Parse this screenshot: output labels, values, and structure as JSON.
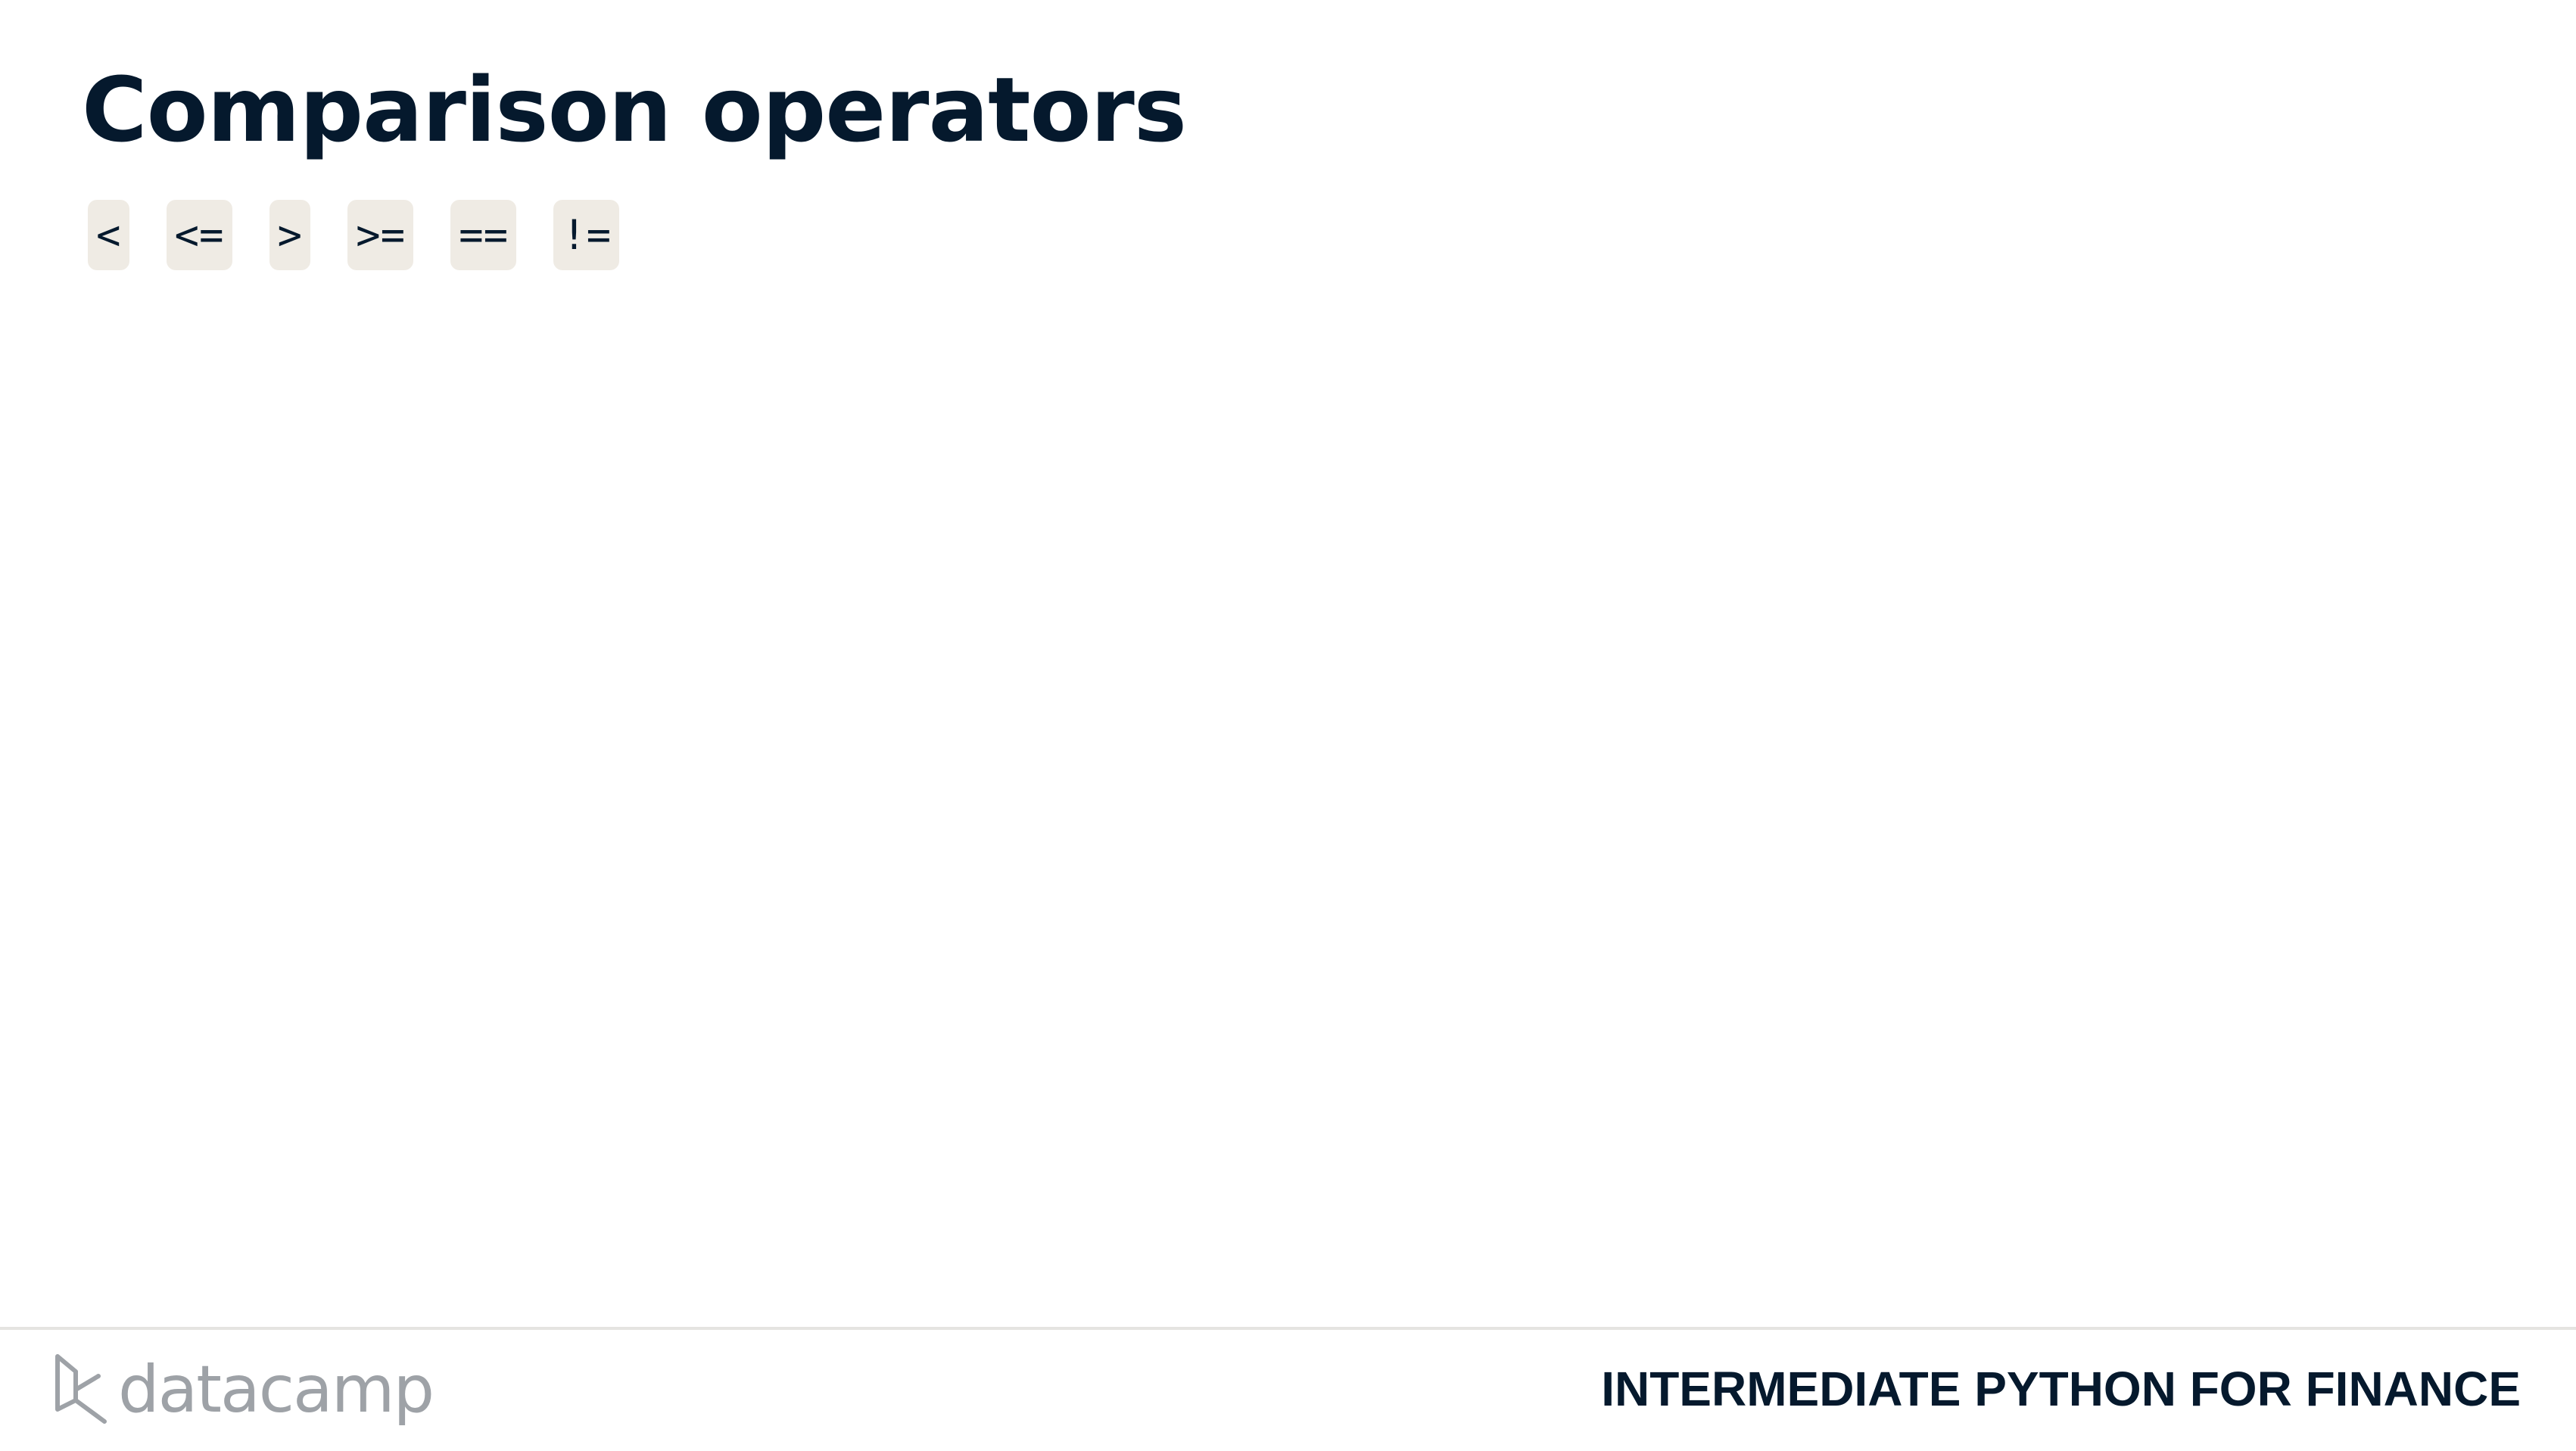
{
  "slide": {
    "title": "Comparison operators",
    "operators": [
      "<",
      "<=",
      ">",
      ">=",
      "==",
      "!="
    ]
  },
  "footer": {
    "brand_name": "datacamp",
    "course_name": "INTERMEDIATE PYTHON FOR FINANCE"
  },
  "colors": {
    "text": "#05192d",
    "chip_background": "#efebe4",
    "brand_gray": "#9ea2a7",
    "divider": "#e5e4e1"
  },
  "icons": {
    "brand_mark": "datacamp-logo-icon"
  }
}
